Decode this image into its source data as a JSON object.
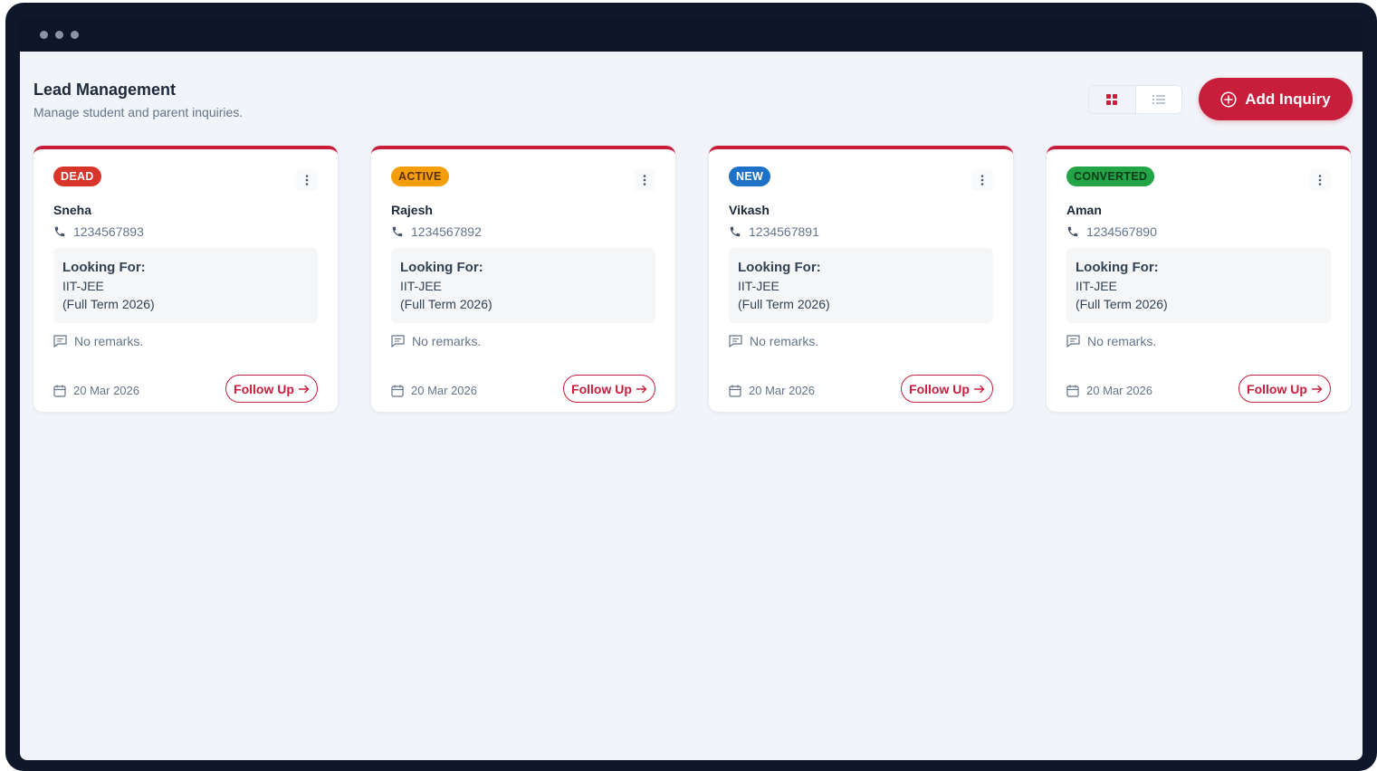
{
  "colors": {
    "accent": "#c81e3c",
    "dead": "#d9362b",
    "active": "#f59e0b",
    "new": "#1d72c8",
    "converted": "#22a447"
  },
  "header": {
    "title": "Lead Management",
    "subtitle": "Manage student and parent inquiries.",
    "view_toggle": {
      "selected": "grid",
      "options": [
        "grid-icon",
        "list-icon"
      ]
    },
    "add_button_label": "Add Inquiry"
  },
  "leads": [
    {
      "status": "DEAD",
      "status_key": "dead",
      "name": "Sneha",
      "phone": "1234567893",
      "looking_label": "Looking For:",
      "course": "IIT-JEE",
      "term": "(Full Term 2026)",
      "remarks": "No remarks.",
      "date": "20 Mar 2026",
      "follow_label": "Follow Up"
    },
    {
      "status": "ACTIVE",
      "status_key": "active",
      "name": "Rajesh",
      "phone": "1234567892",
      "looking_label": "Looking For:",
      "course": "IIT-JEE",
      "term": "(Full Term 2026)",
      "remarks": "No remarks.",
      "date": "20 Mar 2026",
      "follow_label": "Follow Up"
    },
    {
      "status": "NEW",
      "status_key": "new",
      "name": "Vikash",
      "phone": "1234567891",
      "looking_label": "Looking For:",
      "course": "IIT-JEE",
      "term": "(Full Term 2026)",
      "remarks": "No remarks.",
      "date": "20 Mar 2026",
      "follow_label": "Follow Up"
    },
    {
      "status": "CONVERTED",
      "status_key": "converted",
      "name": "Aman",
      "phone": "1234567890",
      "looking_label": "Looking For:",
      "course": "IIT-JEE",
      "term": "(Full Term 2026)",
      "remarks": "No remarks.",
      "date": "20 Mar 2026",
      "follow_label": "Follow Up"
    }
  ]
}
